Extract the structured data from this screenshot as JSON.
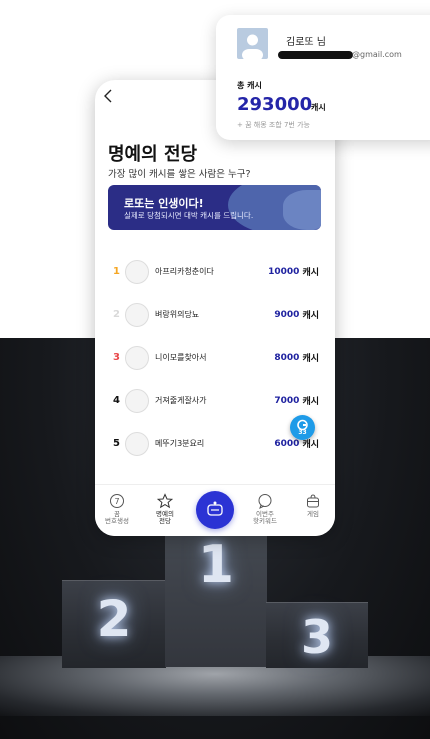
{
  "phone": {
    "title": "명예의 전당",
    "subtitle": "가장 많이 캐시를 쌓은 사람은 누구?",
    "banner": {
      "title": "로또는 인생이다!",
      "subtitle": "실제로 당첨되시면 대박 캐시를 드립니다."
    },
    "rankings": [
      {
        "rank": "1",
        "name": "아프리카청춘이다",
        "cash": "10000",
        "unit": "캐시",
        "rank_color": "#f5a623"
      },
      {
        "rank": "2",
        "name": "벼랑위의당뇨",
        "cash": "9000",
        "unit": "캐시",
        "rank_color": "#d9d9d9"
      },
      {
        "rank": "3",
        "name": "니이모를찾아서",
        "cash": "8000",
        "unit": "캐시",
        "rank_color": "#e8484a"
      },
      {
        "rank": "4",
        "name": "거져줄게잘사가",
        "cash": "7000",
        "unit": "캐시",
        "rank_color": "#111111"
      },
      {
        "rank": "5",
        "name": "메뚜기3분요리",
        "cash": "6000",
        "unit": "캐시",
        "rank_color": "#111111"
      }
    ],
    "fab": {
      "count": "33"
    },
    "tabs": [
      {
        "label": "꿈\n번호생성",
        "icon": "number-seven-icon"
      },
      {
        "label": "명예의\n전당",
        "icon": "star-icon"
      },
      {
        "label": "",
        "icon": "lottery-machine-icon"
      },
      {
        "label": "이번주\n핫키워드",
        "icon": "chat-bubble-icon"
      },
      {
        "label": "게임",
        "icon": "gift-box-icon"
      }
    ]
  },
  "account": {
    "name": "김로또 님",
    "email_domain": "@gmail.com",
    "total_label": "총 캐시",
    "total_value": "293000",
    "total_unit": "캐시",
    "note": "+ 꿈 해몽 조합 7번 가능"
  },
  "podium": {
    "first": "1",
    "second": "2",
    "third": "3"
  },
  "colors": {
    "brand": "#2b33d4",
    "banner": "#2b2d86",
    "cash": "#1f22a0",
    "fab": "#1e9be8"
  }
}
